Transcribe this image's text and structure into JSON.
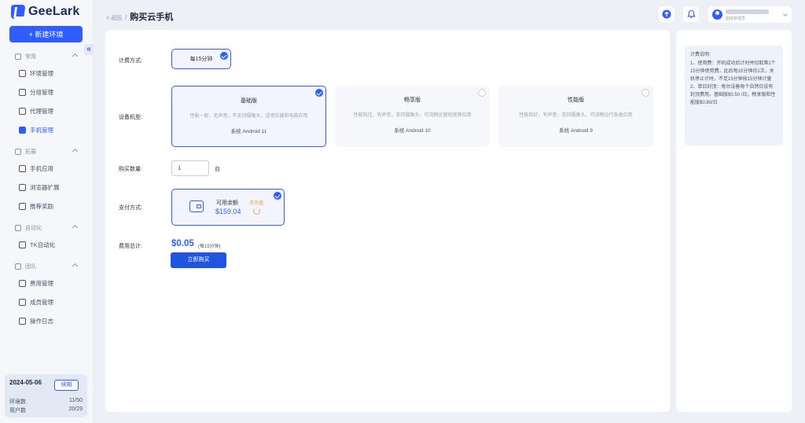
{
  "app": {
    "name": "GeeLark"
  },
  "sidebar": {
    "new_button_label": "+ 新建环境",
    "collapse_label": "«",
    "groups": [
      {
        "title": "常用",
        "items": [
          {
            "label": "环境管理",
            "icon": "browser-icon"
          },
          {
            "label": "分组管理",
            "icon": "group-icon"
          },
          {
            "label": "代理管理",
            "icon": "proxy-icon"
          },
          {
            "label": "手机管理",
            "icon": "phone-icon",
            "active": true
          }
        ]
      },
      {
        "title": "拓展",
        "items": [
          {
            "label": "手机应用",
            "icon": "app-icon"
          },
          {
            "label": "浏览器扩展",
            "icon": "extension-icon"
          },
          {
            "label": "推荐奖励",
            "icon": "gift-icon"
          }
        ]
      },
      {
        "title": "自动化",
        "items": [
          {
            "label": "TK自动化",
            "icon": "tiktok-icon"
          }
        ]
      },
      {
        "title": "团队",
        "items": [
          {
            "label": "费用管理",
            "icon": "billing-icon"
          },
          {
            "label": "成员管理",
            "icon": "members-icon"
          },
          {
            "label": "操作日志",
            "icon": "log-icon"
          }
        ]
      }
    ],
    "stats": {
      "date": "2024-05-06",
      "renew_label": "续期",
      "env_label": "环境数",
      "env_value": "11/50",
      "user_label": "用户数",
      "user_value": "20/29"
    }
  },
  "header": {
    "back_label": "< 返回",
    "separator": "/",
    "title": "购买云手机",
    "user_role": "超级管理员"
  },
  "form": {
    "billing_label": "计费方式:",
    "billing_option": "每15分钟",
    "model_label": "设备机型:",
    "models": [
      {
        "name": "基础版",
        "desc": "性能一般，无声音，不支持摄像头，适用社媒和电商应用",
        "os": "系统 Android 11",
        "selected": true
      },
      {
        "name": "畅享版",
        "desc": "性能较佳，有声音，支持摄像头，可流畅运营短视频应用",
        "os": "系统 Android 10",
        "selected": false
      },
      {
        "name": "性能版",
        "desc": "性能较好，有声音，支持摄像头，可流畅运行各类应用",
        "os": "系统 Android 9",
        "selected": false
      }
    ],
    "quantity_label": "购买数量:",
    "quantity_value": "1",
    "quantity_unit": "台",
    "payment_label": "支付方式:",
    "balance_label": "可用余额",
    "balance_value": "$159.04",
    "recharge_label": "去充值",
    "total_label": "费用总计:",
    "total_value": "$0.05",
    "total_note": "(每15分钟)",
    "buy_label": "立即购买"
  },
  "info": {
    "title": "计费说明:",
    "line1": "1、使用费：开机成功后计时并扣取第1个15分钟使用费，此后每15分钟扣1次，关机停止计时，不足15分钟按15分钟计量",
    "line2": "2、单日封顶：每台设备每个自然日设有封顶费用，基础版$0.50 /日，畅享版和性能版$0.80/日"
  },
  "colors": {
    "accent": "#2f5dff",
    "recharge": "#f0a53a"
  }
}
